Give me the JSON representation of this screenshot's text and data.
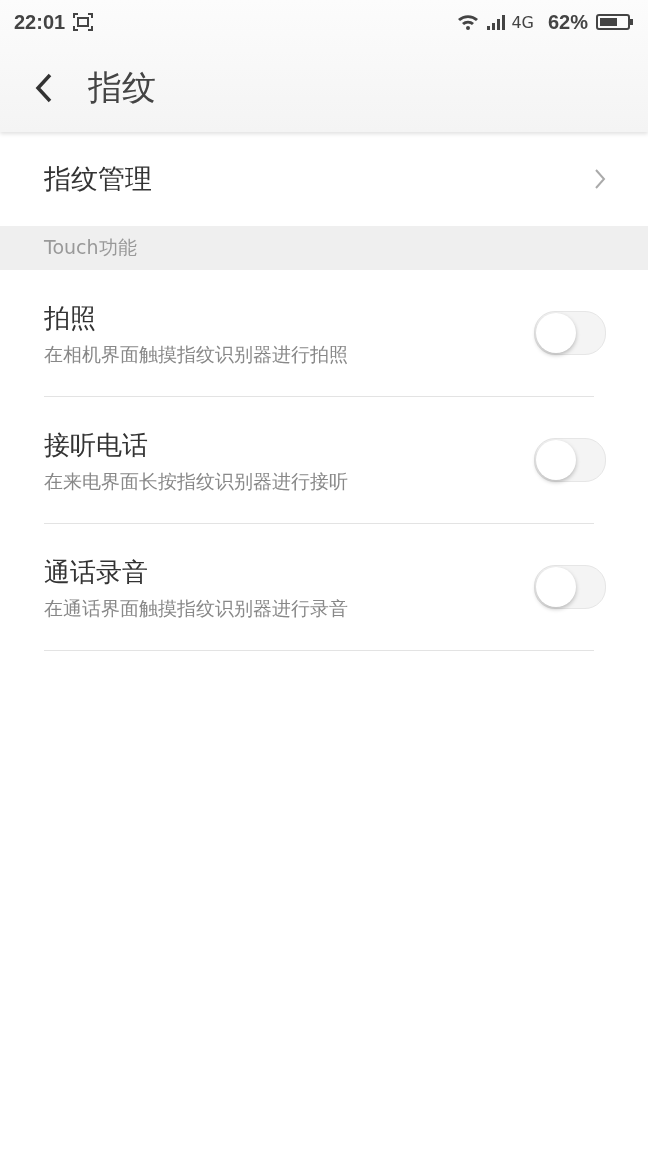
{
  "status_bar": {
    "time": "22:01",
    "network": "4G",
    "battery": "62%"
  },
  "header": {
    "title": "指纹"
  },
  "manage_item": {
    "label": "指纹管理"
  },
  "section": {
    "title": "Touch功能"
  },
  "settings": [
    {
      "title": "拍照",
      "description": "在相机界面触摸指纹识别器进行拍照",
      "on": false
    },
    {
      "title": "接听电话",
      "description": "在来电界面长按指纹识别器进行接听",
      "on": false
    },
    {
      "title": "通话录音",
      "description": "在通话界面触摸指纹识别器进行录音",
      "on": false
    }
  ]
}
